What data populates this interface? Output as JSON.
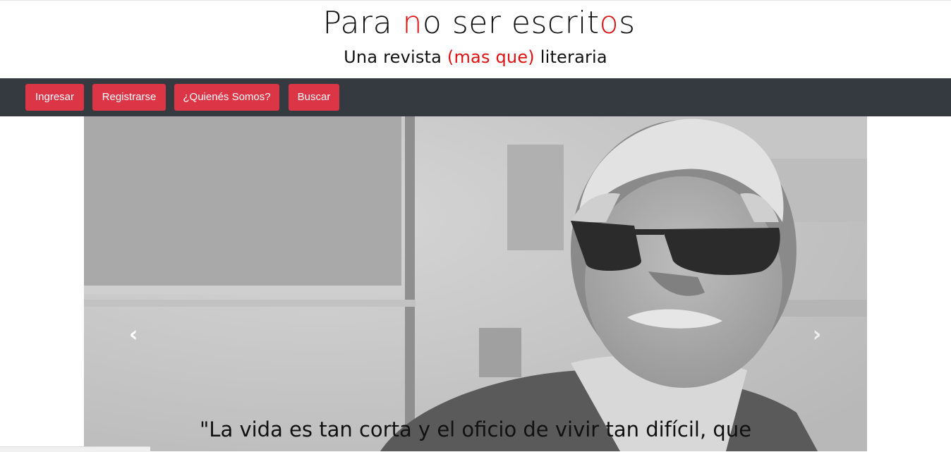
{
  "brand": {
    "title_parts": [
      "Para ",
      "n",
      "o ser escrit",
      "o",
      "s"
    ],
    "subtitle_parts": [
      "Una revista ",
      "(mas que)",
      " literaria"
    ]
  },
  "nav": {
    "items": [
      {
        "label": "Ingresar"
      },
      {
        "label": "Registrarse"
      },
      {
        "label": "¿Quienés Somos?"
      },
      {
        "label": "Buscar"
      }
    ]
  },
  "carousel": {
    "prev_glyph": "‹",
    "next_glyph": "›",
    "caption": "\"La vida es tan corta y el oficio de vivir tan difícil, que"
  },
  "colors": {
    "accent_red": "#dc3545",
    "brand_red": "#e01010",
    "navbar_bg": "#343a40"
  }
}
